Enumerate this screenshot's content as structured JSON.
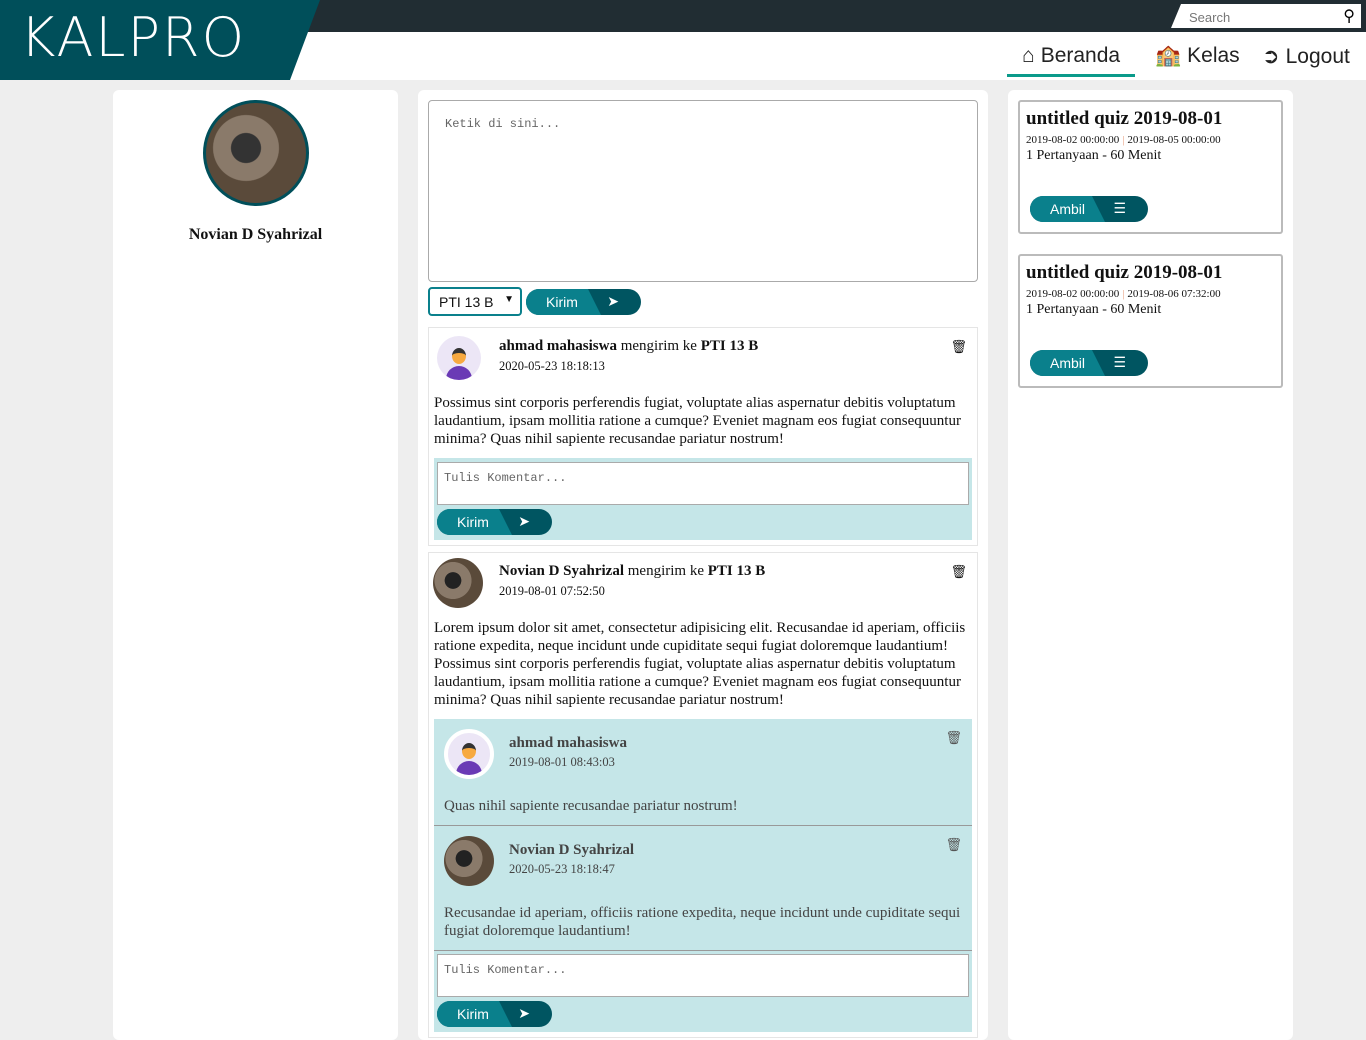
{
  "header": {
    "logo": "KALPRO",
    "search_placeholder": "Search",
    "nav": [
      {
        "label": "Beranda",
        "icon": "home-icon"
      },
      {
        "label": "Kelas",
        "icon": "school-icon"
      },
      {
        "label": "Logout",
        "icon": "logout-icon"
      }
    ]
  },
  "profile": {
    "name": "Novian D Syahrizal"
  },
  "composer": {
    "placeholder": "Ketik di sini...",
    "class_select": "PTI 13 B",
    "send_label": "Kirim"
  },
  "posts": [
    {
      "author": "ahmad mahasiswa",
      "verb": "mengirim ke",
      "target": "PTI 13 B",
      "date": "2020-05-23 18:18:13",
      "body": "Possimus sint corporis perferendis fugiat, voluptate alias aspernatur debitis voluptatum laudantium, ipsam mollitia ratione a cumque? Eveniet magnam eos fugiat consequuntur minima? Quas nihil sapiente recusandae pariatur nostrum!",
      "comment_placeholder": "Tulis Komentar...",
      "send_label": "Kirim",
      "comments": []
    },
    {
      "author": "Novian D Syahrizal",
      "verb": "mengirim ke",
      "target": "PTI 13 B",
      "date": "2019-08-01 07:52:50",
      "body": "Lorem ipsum dolor sit amet, consectetur adipisicing elit. Recusandae id aperiam, officiis ratione expedita, neque incidunt unde cupiditate sequi fugiat doloremque laudantium! Possimus sint corporis perferendis fugiat, voluptate alias aspernatur debitis voluptatum laudantium, ipsam mollitia ratione a cumque? Eveniet magnam eos fugiat consequuntur minima? Quas nihil sapiente recusandae pariatur nostrum!",
      "comment_placeholder": "Tulis Komentar...",
      "send_label": "Kirim",
      "comments": [
        {
          "author": "ahmad mahasiswa",
          "date": "2019-08-01 08:43:03",
          "text": "Quas nihil sapiente recusandae pariatur nostrum!"
        },
        {
          "author": "Novian D Syahrizal",
          "date": "2020-05-23 18:18:47",
          "text": "Recusandae id aperiam, officiis ratione expedita, neque incidunt unde cupiditate sequi fugiat doloremque laudantium!"
        }
      ]
    }
  ],
  "quizzes": [
    {
      "title": "untitled quiz 2019-08-01",
      "start": "2019-08-02 00:00:00",
      "end": "2019-08-05 00:00:00",
      "meta": "1 Pertanyaan - 60 Menit",
      "button": "Ambil"
    },
    {
      "title": "untitled quiz 2019-08-01",
      "start": "2019-08-02 00:00:00",
      "end": "2019-08-06 07:32:00",
      "meta": "1 Pertanyaan - 60 Menit",
      "button": "Ambil"
    }
  ],
  "colors": {
    "brand": "#004f5a",
    "accent": "#0a808c",
    "comment_bg": "#c5e6e8"
  }
}
